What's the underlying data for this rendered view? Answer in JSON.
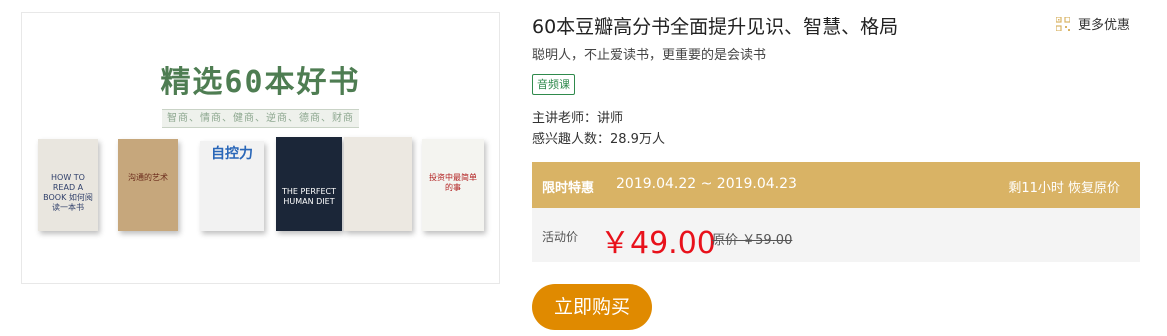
{
  "cover": {
    "title": "精选60本好书",
    "subtitle": "智商、情商、健商、逆商、德商、财商",
    "books": [
      {
        "label": "HOW TO READ A BOOK 如何阅读一本书",
        "bg": "#e9e6df",
        "color": "#2f3f6a"
      },
      {
        "label": "沟通的艺术",
        "bg": "#c6a77c",
        "color": "#6a2a1a"
      },
      {
        "label": "自控力",
        "bg": "#f2f2f2",
        "color": "#2a67b8"
      },
      {
        "label": "THE PERFECT HUMAN DIET",
        "bg": "#1b2638",
        "color": "#ffffff"
      },
      {
        "label": "",
        "bg": "#ece8e1",
        "color": "#777777"
      },
      {
        "label": "投资中最简单的事",
        "bg": "#f4f4f0",
        "color": "#b11d1d"
      }
    ]
  },
  "title": "60本豆瓣高分书全面提升见识、智慧、格局",
  "subtitle": "聪明人，不止爱读书，更重要的是会读书",
  "tag": "音频课",
  "teacher": "主讲老师：讲师",
  "interest": "感兴趣人数：28.9万人",
  "more_offers": "更多优惠",
  "promo": {
    "label": "限时特惠",
    "dates": "2019.04.22 ~ 2019.04.23",
    "remaining": "剩11小时 恢复原价"
  },
  "price": {
    "label": "活动价",
    "current": "￥49.00",
    "original": "原价 ￥59.00"
  },
  "buy_label": "立即购买",
  "colors": {
    "promo_bg": "#d9b365",
    "price_red": "#e8111b",
    "buy_btn": "#e08a00",
    "tag_green": "#2f8a4c"
  }
}
